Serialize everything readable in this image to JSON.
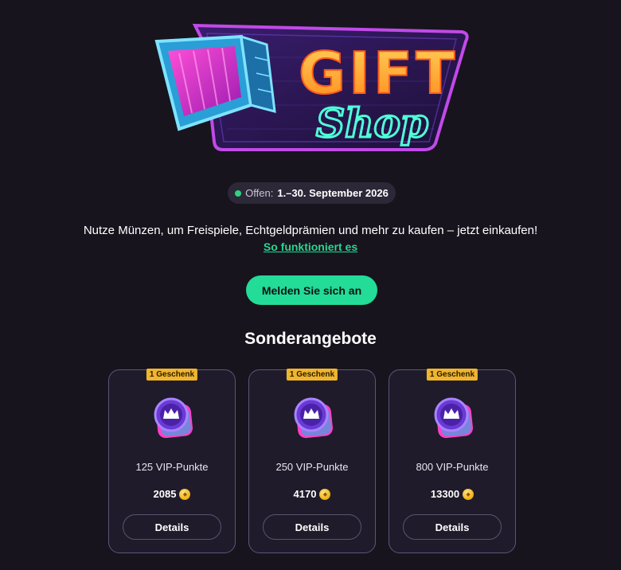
{
  "hero": {
    "logo_word_1": "GIFT",
    "logo_word_2": "Shop"
  },
  "status": {
    "label": "Offen:",
    "value": "1.–30. September 2026",
    "dot_color": "#2ed37e"
  },
  "intro": {
    "text": "Nutze Münzen, um Freispiele, Echtgeldprämien und mehr zu kaufen – jetzt einkaufen!",
    "link": "So funktioniert es"
  },
  "cta": {
    "label": "Melden Sie sich an",
    "color": "#22dc97"
  },
  "section": {
    "title": "Sonderangebote"
  },
  "offers": [
    {
      "badge": "1 Geschenk",
      "title": "125 VIP-Punkte",
      "price": "2085",
      "button": "Details",
      "icon": "vip-crown-gem-icon"
    },
    {
      "badge": "1 Geschenk",
      "title": "250 VIP-Punkte",
      "price": "4170",
      "button": "Details",
      "icon": "vip-crown-gem-icon"
    },
    {
      "badge": "1 Geschenk",
      "title": "800 VIP-Punkte",
      "price": "13300",
      "button": "Details",
      "icon": "vip-crown-gem-icon"
    }
  ],
  "colors": {
    "background": "#17141d",
    "accent": "#22dc97",
    "badge": "#f0b52e",
    "card_border": "#5d557a"
  }
}
